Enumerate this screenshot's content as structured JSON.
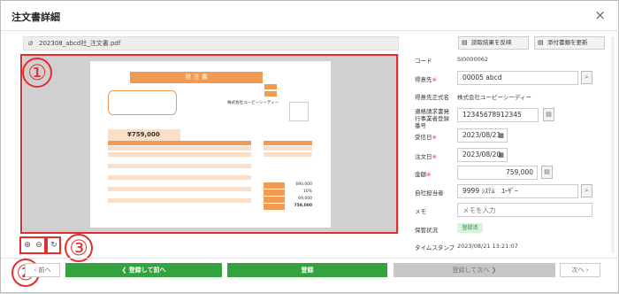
{
  "dialog": {
    "title": "注文書詳細",
    "close_icon": "×"
  },
  "file": {
    "name": "202308_abcd社_注文書.pdf"
  },
  "toolbar": {
    "reflect_label": "読取結果を反映",
    "update_attachment_label": "添付書類を更新"
  },
  "annotations": {
    "one": "①",
    "two": "②",
    "three": "③"
  },
  "document_preview": {
    "heading": "発 注 書",
    "total": "¥759,000",
    "company": "株式会社ユーピーシーディー",
    "sub_total_rows": [
      "690,000",
      "10%",
      "69,000",
      "759,000"
    ]
  },
  "form": {
    "code": {
      "label": "コード",
      "value": "SI0000062"
    },
    "client": {
      "label": "得意先",
      "value": "00005 abcd"
    },
    "client_official": {
      "label": "得意先正式名",
      "value": "株式会社ユーピーシーディー"
    },
    "invoice_no": {
      "label": "適格請求書発行事業者登録番号",
      "value": "12345678912345"
    },
    "received_date": {
      "label": "受信日",
      "value": "2023/08/21"
    },
    "order_date": {
      "label": "注文日",
      "value": "2023/08/20"
    },
    "amount": {
      "label": "金額",
      "value": "759,000"
    },
    "staff": {
      "label": "自社担当者",
      "value": "9999 ｼｽﾃﾑ　ﾕｰｻﾞｰ"
    },
    "memo": {
      "label": "メモ",
      "placeholder": "メモを入力"
    },
    "save_status": {
      "label": "保管状況",
      "value": "登録済"
    },
    "timestamp": {
      "label": "タイムスタンプ",
      "value": "2023/08/21 13:21:07"
    }
  },
  "footer": {
    "prev_label": "前へ",
    "register_prev_label": "登録して前へ",
    "register_label": "登録",
    "register_next_label": "登録して次へ",
    "next_label": "次へ"
  },
  "colors": {
    "accent_green": "#33a23f",
    "annotation_red": "#e52d2d",
    "doc_orange": "#f19a52"
  }
}
